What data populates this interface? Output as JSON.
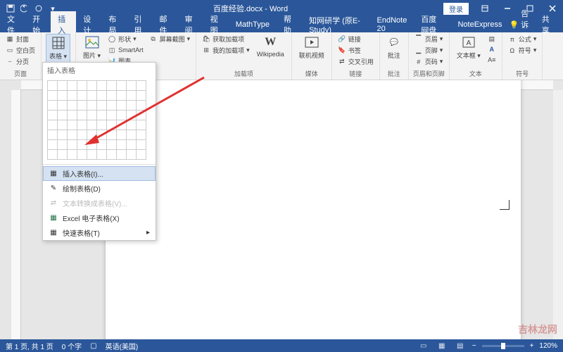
{
  "title": "百度经验.docx - Word",
  "login": "登录",
  "menus": [
    "文件",
    "开始",
    "插入",
    "设计",
    "布局",
    "引用",
    "邮件",
    "审阅",
    "视图",
    "MathType",
    "帮助",
    "知网研学 (原E-Study)",
    "EndNote 20",
    "百度网盘",
    "NoteExpress"
  ],
  "active_menu": "插入",
  "tell_me": "告诉我",
  "share": "共享",
  "ribbon": {
    "page": {
      "label": "页面",
      "cover": "封面",
      "blank": "空白页",
      "break": "分页"
    },
    "table": {
      "label": "插入表格",
      "btn": "表格"
    },
    "illus": {
      "pic": "图片",
      "shape": "形状",
      "smartart": "SmartArt",
      "chart": "图表",
      "screenshot": "屏幕截图"
    },
    "addin": {
      "label": "加载项",
      "get": "获取加载项",
      "my": "我的加载项",
      "wiki": "Wikipedia"
    },
    "media": {
      "label": "媒体",
      "video": "联机视频"
    },
    "link": {
      "label": "链接",
      "link": "链接",
      "bookmark": "书签",
      "xref": "交叉引用"
    },
    "comment": {
      "label": "批注",
      "btn": "批注"
    },
    "header": {
      "label": "页眉和页脚",
      "header": "页眉",
      "footer": "页脚",
      "pagenum": "页码"
    },
    "text": {
      "label": "文本",
      "textbox": "文本框"
    },
    "symbol": {
      "label": "符号",
      "eq": "公式",
      "sym": "符号"
    }
  },
  "dropdown": {
    "header": "插入表格",
    "insert": "插入表格(I)...",
    "draw": "绘制表格(D)",
    "convert": "文本转换成表格(V)...",
    "excel": "Excel 电子表格(X)",
    "quick": "快速表格(T)"
  },
  "status": {
    "page": "第 1 页, 共 1 页",
    "words": "0 个字",
    "lang": "英语(美国)",
    "zoom": "120%"
  },
  "watermark": "吉林龙网"
}
